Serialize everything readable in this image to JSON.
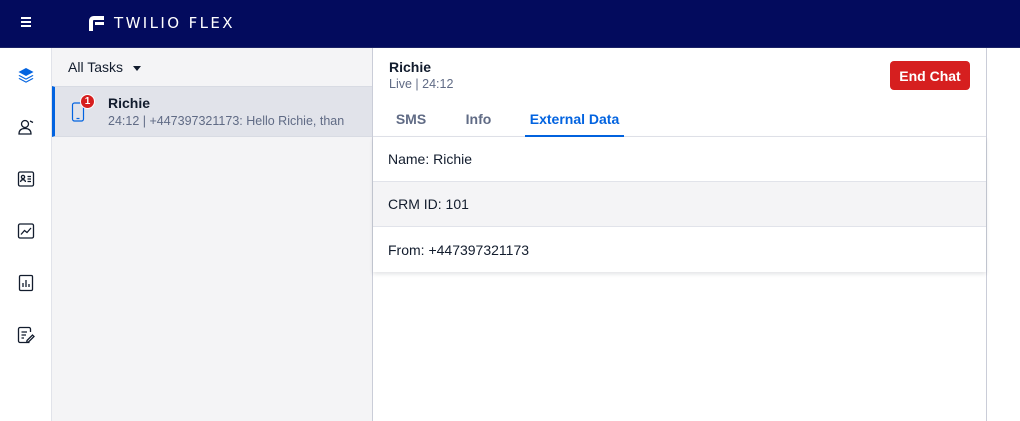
{
  "topbar": {
    "brand": "TWILIO FLEX"
  },
  "rail": {
    "items": [
      {
        "icon": "layers-icon",
        "active": true
      },
      {
        "icon": "agents-icon",
        "active": false
      },
      {
        "icon": "directory-icon",
        "active": false
      },
      {
        "icon": "analytics-icon",
        "active": false
      },
      {
        "icon": "reports-icon",
        "active": false
      },
      {
        "icon": "quality-icon",
        "active": false
      }
    ]
  },
  "tasklist": {
    "filter_label": "All Tasks",
    "task": {
      "badge": "1",
      "name": "Richie",
      "subtitle": "24:12 | +447397321173: Hello Richie, than"
    }
  },
  "main": {
    "name": "Richie",
    "status": "Live | 24:12",
    "end_chat_label": "End Chat",
    "tabs": [
      {
        "label": "SMS",
        "active": false
      },
      {
        "label": "Info",
        "active": false
      },
      {
        "label": "External Data",
        "active": true
      }
    ],
    "rows": [
      "Name: Richie",
      "CRM ID: 101",
      "From: +447397321173"
    ]
  },
  "colors": {
    "topbar": "#030b5d",
    "accent": "#0263e0",
    "danger": "#d61f1f"
  }
}
